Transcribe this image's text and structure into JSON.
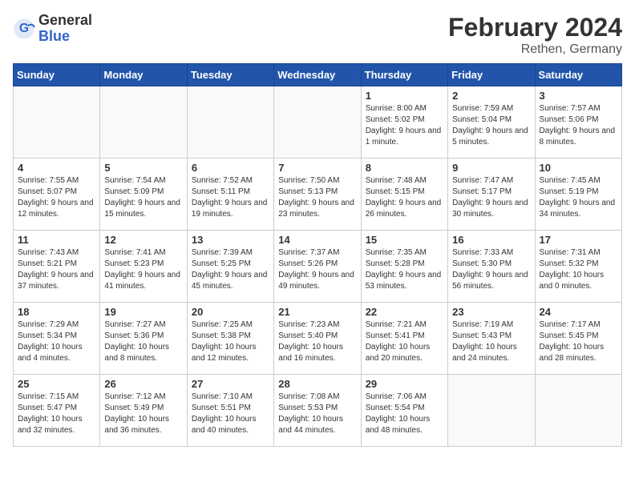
{
  "header": {
    "logo_general": "General",
    "logo_blue": "Blue",
    "month_year": "February 2024",
    "location": "Rethen, Germany"
  },
  "weekdays": [
    "Sunday",
    "Monday",
    "Tuesday",
    "Wednesday",
    "Thursday",
    "Friday",
    "Saturday"
  ],
  "weeks": [
    [
      {
        "day": "",
        "info": ""
      },
      {
        "day": "",
        "info": ""
      },
      {
        "day": "",
        "info": ""
      },
      {
        "day": "",
        "info": ""
      },
      {
        "day": "1",
        "info": "Sunrise: 8:00 AM\nSunset: 5:02 PM\nDaylight: 9 hours\nand 1 minute."
      },
      {
        "day": "2",
        "info": "Sunrise: 7:59 AM\nSunset: 5:04 PM\nDaylight: 9 hours\nand 5 minutes."
      },
      {
        "day": "3",
        "info": "Sunrise: 7:57 AM\nSunset: 5:06 PM\nDaylight: 9 hours\nand 8 minutes."
      }
    ],
    [
      {
        "day": "4",
        "info": "Sunrise: 7:55 AM\nSunset: 5:07 PM\nDaylight: 9 hours\nand 12 minutes."
      },
      {
        "day": "5",
        "info": "Sunrise: 7:54 AM\nSunset: 5:09 PM\nDaylight: 9 hours\nand 15 minutes."
      },
      {
        "day": "6",
        "info": "Sunrise: 7:52 AM\nSunset: 5:11 PM\nDaylight: 9 hours\nand 19 minutes."
      },
      {
        "day": "7",
        "info": "Sunrise: 7:50 AM\nSunset: 5:13 PM\nDaylight: 9 hours\nand 23 minutes."
      },
      {
        "day": "8",
        "info": "Sunrise: 7:48 AM\nSunset: 5:15 PM\nDaylight: 9 hours\nand 26 minutes."
      },
      {
        "day": "9",
        "info": "Sunrise: 7:47 AM\nSunset: 5:17 PM\nDaylight: 9 hours\nand 30 minutes."
      },
      {
        "day": "10",
        "info": "Sunrise: 7:45 AM\nSunset: 5:19 PM\nDaylight: 9 hours\nand 34 minutes."
      }
    ],
    [
      {
        "day": "11",
        "info": "Sunrise: 7:43 AM\nSunset: 5:21 PM\nDaylight: 9 hours\nand 37 minutes."
      },
      {
        "day": "12",
        "info": "Sunrise: 7:41 AM\nSunset: 5:23 PM\nDaylight: 9 hours\nand 41 minutes."
      },
      {
        "day": "13",
        "info": "Sunrise: 7:39 AM\nSunset: 5:25 PM\nDaylight: 9 hours\nand 45 minutes."
      },
      {
        "day": "14",
        "info": "Sunrise: 7:37 AM\nSunset: 5:26 PM\nDaylight: 9 hours\nand 49 minutes."
      },
      {
        "day": "15",
        "info": "Sunrise: 7:35 AM\nSunset: 5:28 PM\nDaylight: 9 hours\nand 53 minutes."
      },
      {
        "day": "16",
        "info": "Sunrise: 7:33 AM\nSunset: 5:30 PM\nDaylight: 9 hours\nand 56 minutes."
      },
      {
        "day": "17",
        "info": "Sunrise: 7:31 AM\nSunset: 5:32 PM\nDaylight: 10 hours\nand 0 minutes."
      }
    ],
    [
      {
        "day": "18",
        "info": "Sunrise: 7:29 AM\nSunset: 5:34 PM\nDaylight: 10 hours\nand 4 minutes."
      },
      {
        "day": "19",
        "info": "Sunrise: 7:27 AM\nSunset: 5:36 PM\nDaylight: 10 hours\nand 8 minutes."
      },
      {
        "day": "20",
        "info": "Sunrise: 7:25 AM\nSunset: 5:38 PM\nDaylight: 10 hours\nand 12 minutes."
      },
      {
        "day": "21",
        "info": "Sunrise: 7:23 AM\nSunset: 5:40 PM\nDaylight: 10 hours\nand 16 minutes."
      },
      {
        "day": "22",
        "info": "Sunrise: 7:21 AM\nSunset: 5:41 PM\nDaylight: 10 hours\nand 20 minutes."
      },
      {
        "day": "23",
        "info": "Sunrise: 7:19 AM\nSunset: 5:43 PM\nDaylight: 10 hours\nand 24 minutes."
      },
      {
        "day": "24",
        "info": "Sunrise: 7:17 AM\nSunset: 5:45 PM\nDaylight: 10 hours\nand 28 minutes."
      }
    ],
    [
      {
        "day": "25",
        "info": "Sunrise: 7:15 AM\nSunset: 5:47 PM\nDaylight: 10 hours\nand 32 minutes."
      },
      {
        "day": "26",
        "info": "Sunrise: 7:12 AM\nSunset: 5:49 PM\nDaylight: 10 hours\nand 36 minutes."
      },
      {
        "day": "27",
        "info": "Sunrise: 7:10 AM\nSunset: 5:51 PM\nDaylight: 10 hours\nand 40 minutes."
      },
      {
        "day": "28",
        "info": "Sunrise: 7:08 AM\nSunset: 5:53 PM\nDaylight: 10 hours\nand 44 minutes."
      },
      {
        "day": "29",
        "info": "Sunrise: 7:06 AM\nSunset: 5:54 PM\nDaylight: 10 hours\nand 48 minutes."
      },
      {
        "day": "",
        "info": ""
      },
      {
        "day": "",
        "info": ""
      }
    ]
  ]
}
